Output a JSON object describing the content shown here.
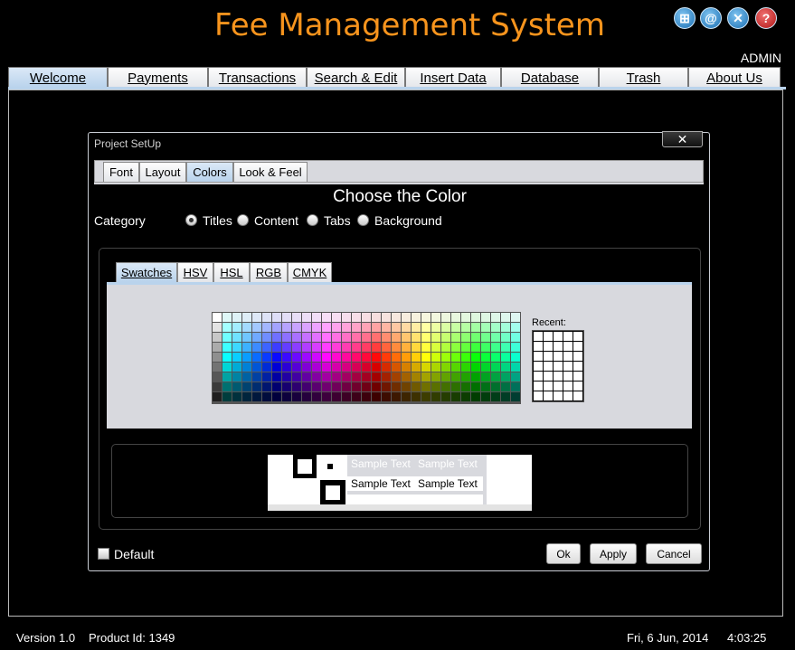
{
  "app": {
    "title": "Fee Management System",
    "user": "ADMIN",
    "icons": [
      "dashboard-icon",
      "email-icon",
      "tools-icon",
      "help-icon"
    ]
  },
  "main_tabs": [
    {
      "label": "Welcome",
      "active": true
    },
    {
      "label": "Payments"
    },
    {
      "label": "Transactions"
    },
    {
      "label": "Search & Edit"
    },
    {
      "label": "Insert Data"
    },
    {
      "label": "Database"
    },
    {
      "label": "Trash"
    },
    {
      "label": "About Us"
    }
  ],
  "dialog": {
    "title": "Project SetUp",
    "close_symbol": "✕",
    "tabs": [
      {
        "label": "Font"
      },
      {
        "label": "Layout"
      },
      {
        "label": "Colors",
        "active": true
      },
      {
        "label": "Look & Feel"
      }
    ],
    "section_title": "Choose the Color",
    "category": {
      "label": "Category",
      "options": [
        {
          "label": "Titles",
          "checked": true
        },
        {
          "label": "Content"
        },
        {
          "label": "Tabs"
        },
        {
          "label": "Background"
        }
      ]
    },
    "chooser_tabs": [
      {
        "label": "Swatches",
        "active": true
      },
      {
        "label": "HSV"
      },
      {
        "label": "HSL"
      },
      {
        "label": "RGB"
      },
      {
        "label": "CMYK"
      }
    ],
    "recent_label": "Recent:",
    "preview": {
      "sample_1": "Sample Text",
      "sample_2": "Sample Text",
      "sample_3": "Sample Text",
      "sample_4": "Sample Text"
    },
    "default_label": "Default",
    "buttons": {
      "ok": "Ok",
      "apply": "Apply",
      "cancel": "Cancel"
    }
  },
  "status_bar": {
    "version": "Version 1.0",
    "product": "Product Id: 1349",
    "date": "Fri, 6 Jun, 2014",
    "time": "4:03:25"
  },
  "colors": {
    "title": "#f7941d",
    "background": "#000000",
    "panel": "#d8d9de",
    "tab_active": "#b9d3ec"
  }
}
